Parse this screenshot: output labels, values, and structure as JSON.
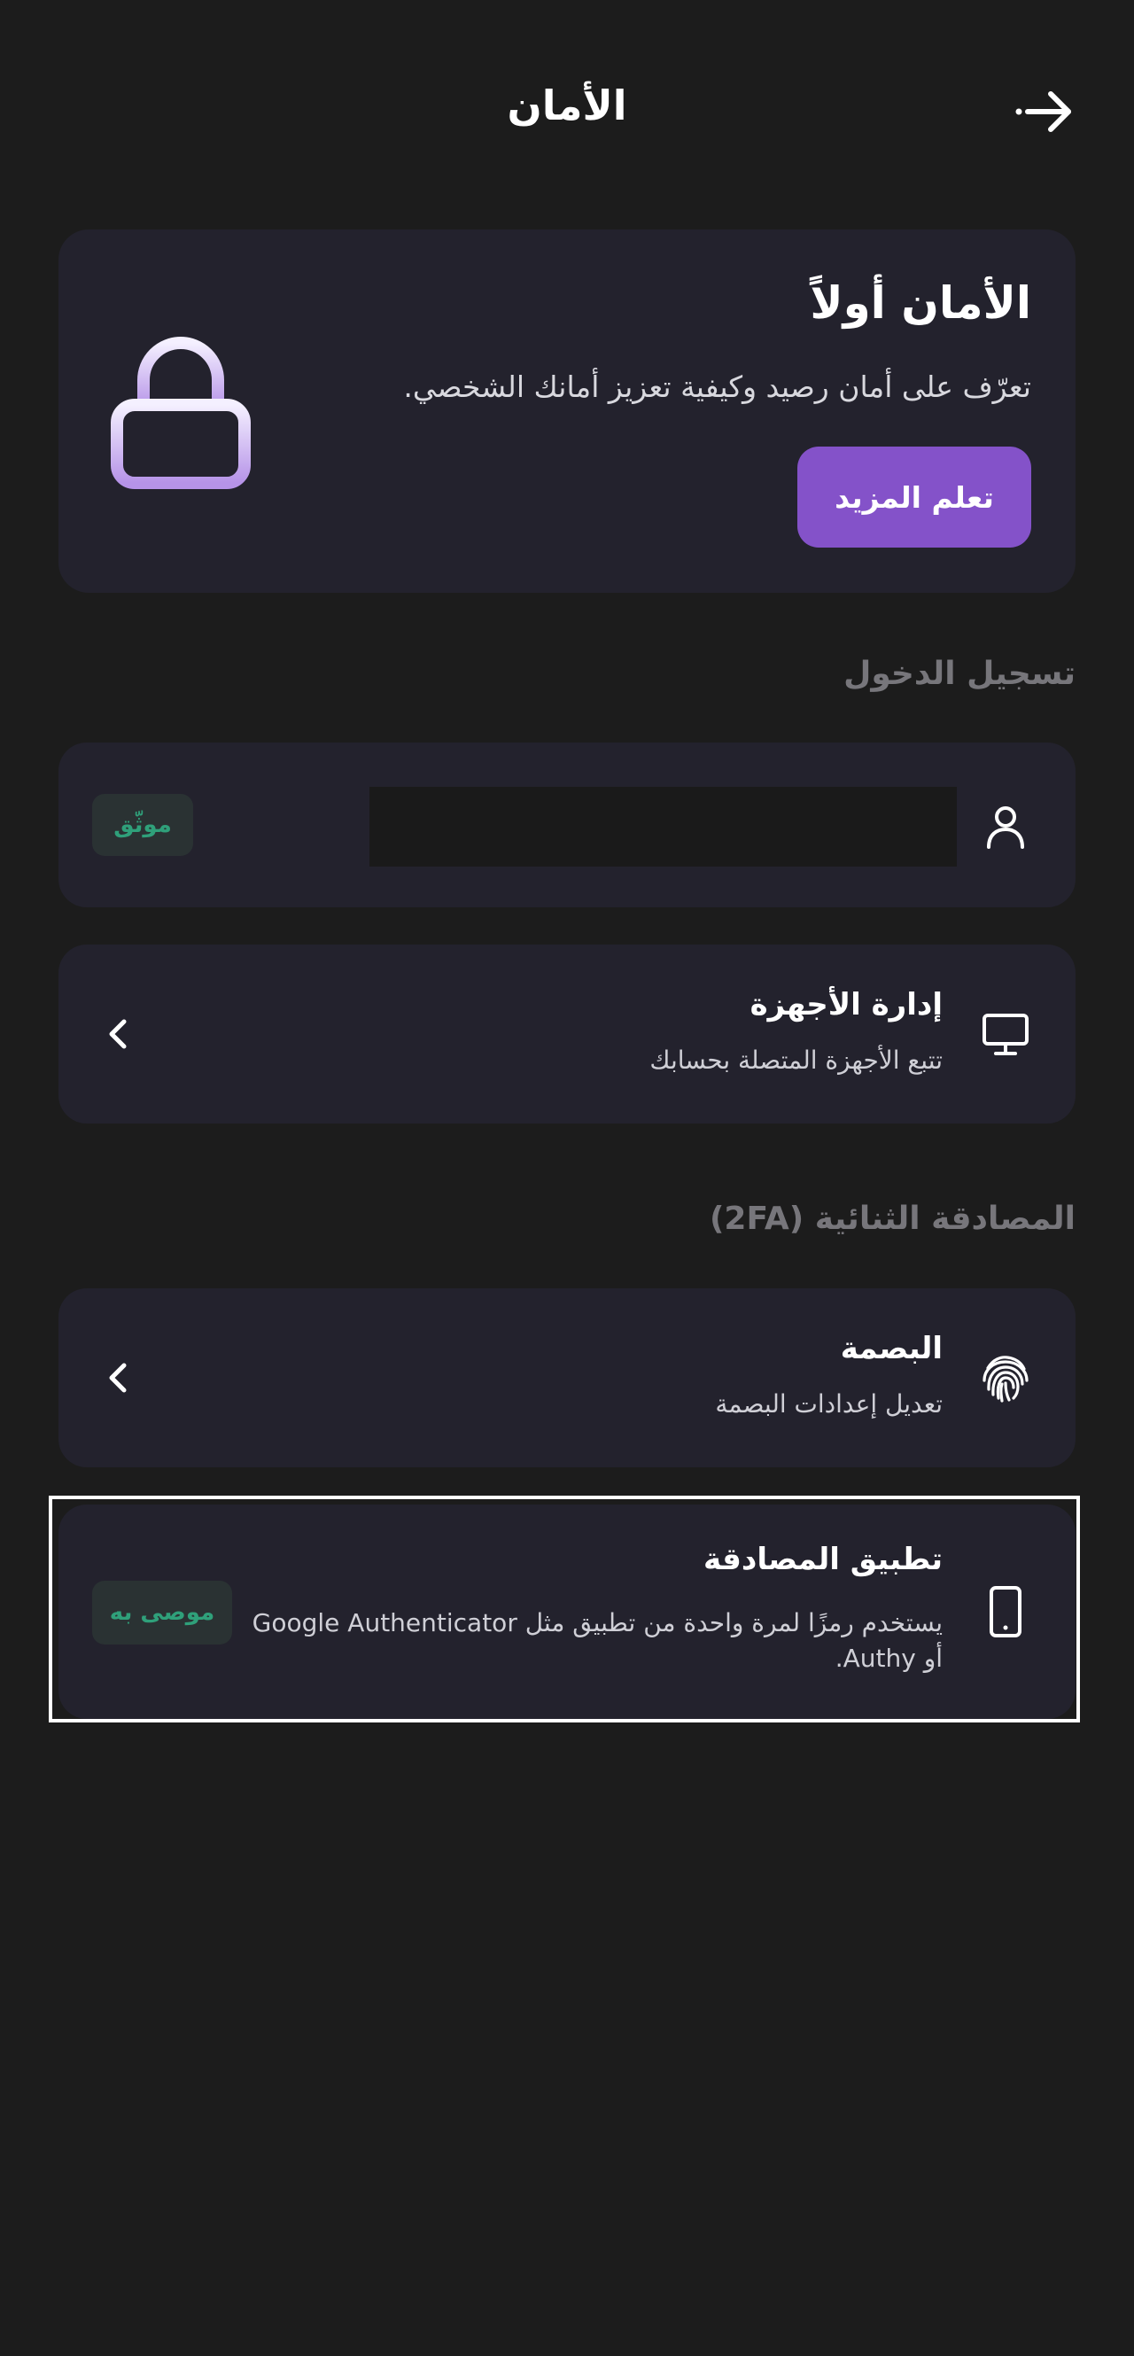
{
  "header": {
    "title": "الأمان",
    "back_icon": "arrow-right-icon"
  },
  "hero": {
    "title": "الأمان أولاً",
    "description": "تعرّف على أمان رصيد وكيفية تعزيز أمانك الشخصي.",
    "button_label": "تعلم المزيد",
    "icon": "lock-icon",
    "accent_color": "#8452c9"
  },
  "login_section": {
    "label": "تسجيل الدخول",
    "account_row": {
      "icon": "user-icon",
      "badge": "موثّق"
    },
    "devices_row": {
      "icon": "monitor-icon",
      "title": "إدارة الأجهزة",
      "subtitle": "تتبع الأجهزة المتصلة بحسابك"
    }
  },
  "twofa_section": {
    "label": "المصادقة الثنائية (2FA)",
    "fingerprint_row": {
      "icon": "fingerprint-icon",
      "title": "البصمة",
      "subtitle": "تعديل إعدادات البصمة"
    },
    "authenticator_row": {
      "icon": "smartphone-icon",
      "title": "تطبيق المصادقة",
      "subtitle": "يستخدم رمزًا لمرة واحدة من تطبيق مثل Google Authenticator أو Authy.",
      "badge": "موصى به"
    }
  },
  "colors": {
    "background": "#1c1c1c",
    "card": "#23222d",
    "badge_text": "#2fa07a"
  }
}
